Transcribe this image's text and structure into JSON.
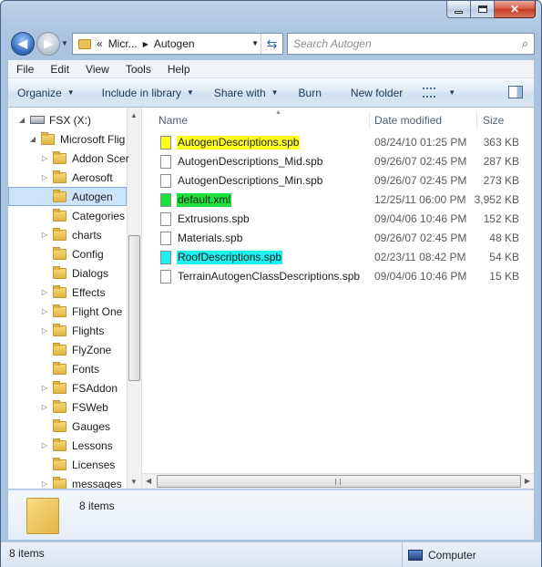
{
  "address": {
    "path": [
      "«",
      "Micr...",
      "Autogen"
    ]
  },
  "search": {
    "placeholder": "Search Autogen"
  },
  "menu": [
    "File",
    "Edit",
    "View",
    "Tools",
    "Help"
  ],
  "toolbar": {
    "organize": "Organize",
    "include": "Include in library",
    "share": "Share with",
    "burn": "Burn",
    "new_folder": "New folder"
  },
  "tree": [
    {
      "label": "FSX (X:)",
      "level": 0,
      "expander": "◢",
      "type": "drive"
    },
    {
      "label": "Microsoft Flig",
      "level": 1,
      "expander": "◢",
      "type": "folder"
    },
    {
      "label": "Addon Scer",
      "level": 2,
      "expander": "▷",
      "type": "folder"
    },
    {
      "label": "Aerosoft",
      "level": 2,
      "expander": "▷",
      "type": "folder"
    },
    {
      "label": "Autogen",
      "level": 2,
      "expander": "",
      "type": "folder",
      "selected": true
    },
    {
      "label": "Categories",
      "level": 2,
      "expander": "",
      "type": "folder"
    },
    {
      "label": "charts",
      "level": 2,
      "expander": "▷",
      "type": "folder"
    },
    {
      "label": "Config",
      "level": 2,
      "expander": "",
      "type": "folder"
    },
    {
      "label": "Dialogs",
      "level": 2,
      "expander": "",
      "type": "folder"
    },
    {
      "label": "Effects",
      "level": 2,
      "expander": "▷",
      "type": "folder"
    },
    {
      "label": "Flight One",
      "level": 2,
      "expander": "▷",
      "type": "folder"
    },
    {
      "label": "Flights",
      "level": 2,
      "expander": "▷",
      "type": "folder"
    },
    {
      "label": "FlyZone",
      "level": 2,
      "expander": "",
      "type": "folder"
    },
    {
      "label": "Fonts",
      "level": 2,
      "expander": "",
      "type": "folder"
    },
    {
      "label": "FSAddon",
      "level": 2,
      "expander": "▷",
      "type": "folder"
    },
    {
      "label": "FSWeb",
      "level": 2,
      "expander": "▷",
      "type": "folder"
    },
    {
      "label": "Gauges",
      "level": 2,
      "expander": "",
      "type": "folder"
    },
    {
      "label": "Lessons",
      "level": 2,
      "expander": "▷",
      "type": "folder"
    },
    {
      "label": "Licenses",
      "level": 2,
      "expander": "",
      "type": "folder"
    },
    {
      "label": "messages",
      "level": 2,
      "expander": "▷",
      "type": "folder"
    }
  ],
  "columns": {
    "name": "Name",
    "date": "Date modified",
    "size": "Size"
  },
  "files": [
    {
      "name": "AutogenDescriptions.spb",
      "date": "08/24/10 01:25 PM",
      "size": "363 KB",
      "highlight": "#ffff1e"
    },
    {
      "name": "AutogenDescriptions_Mid.spb",
      "date": "09/26/07 02:45 PM",
      "size": "287 KB",
      "highlight": ""
    },
    {
      "name": "AutogenDescriptions_Min.spb",
      "date": "09/26/07 02:45 PM",
      "size": "273 KB",
      "highlight": ""
    },
    {
      "name": "default.xml",
      "date": "12/25/11 06:00 PM",
      "size": "3,952 KB",
      "highlight": "#1ee23c"
    },
    {
      "name": "Extrusions.spb",
      "date": "09/04/06 10:46 PM",
      "size": "152 KB",
      "highlight": ""
    },
    {
      "name": "Materials.spb",
      "date": "09/26/07 02:45 PM",
      "size": "48 KB",
      "highlight": ""
    },
    {
      "name": "RoofDescriptions.spb",
      "date": "02/23/11 08:42 PM",
      "size": "54 KB",
      "highlight": "#1ef0f0"
    },
    {
      "name": "TerrainAutogenClassDescriptions.spb",
      "date": "09/04/06 10:46 PM",
      "size": "15 KB",
      "highlight": ""
    }
  ],
  "details": {
    "count": "8 items"
  },
  "status": {
    "left": "8 items",
    "right": "Computer"
  }
}
